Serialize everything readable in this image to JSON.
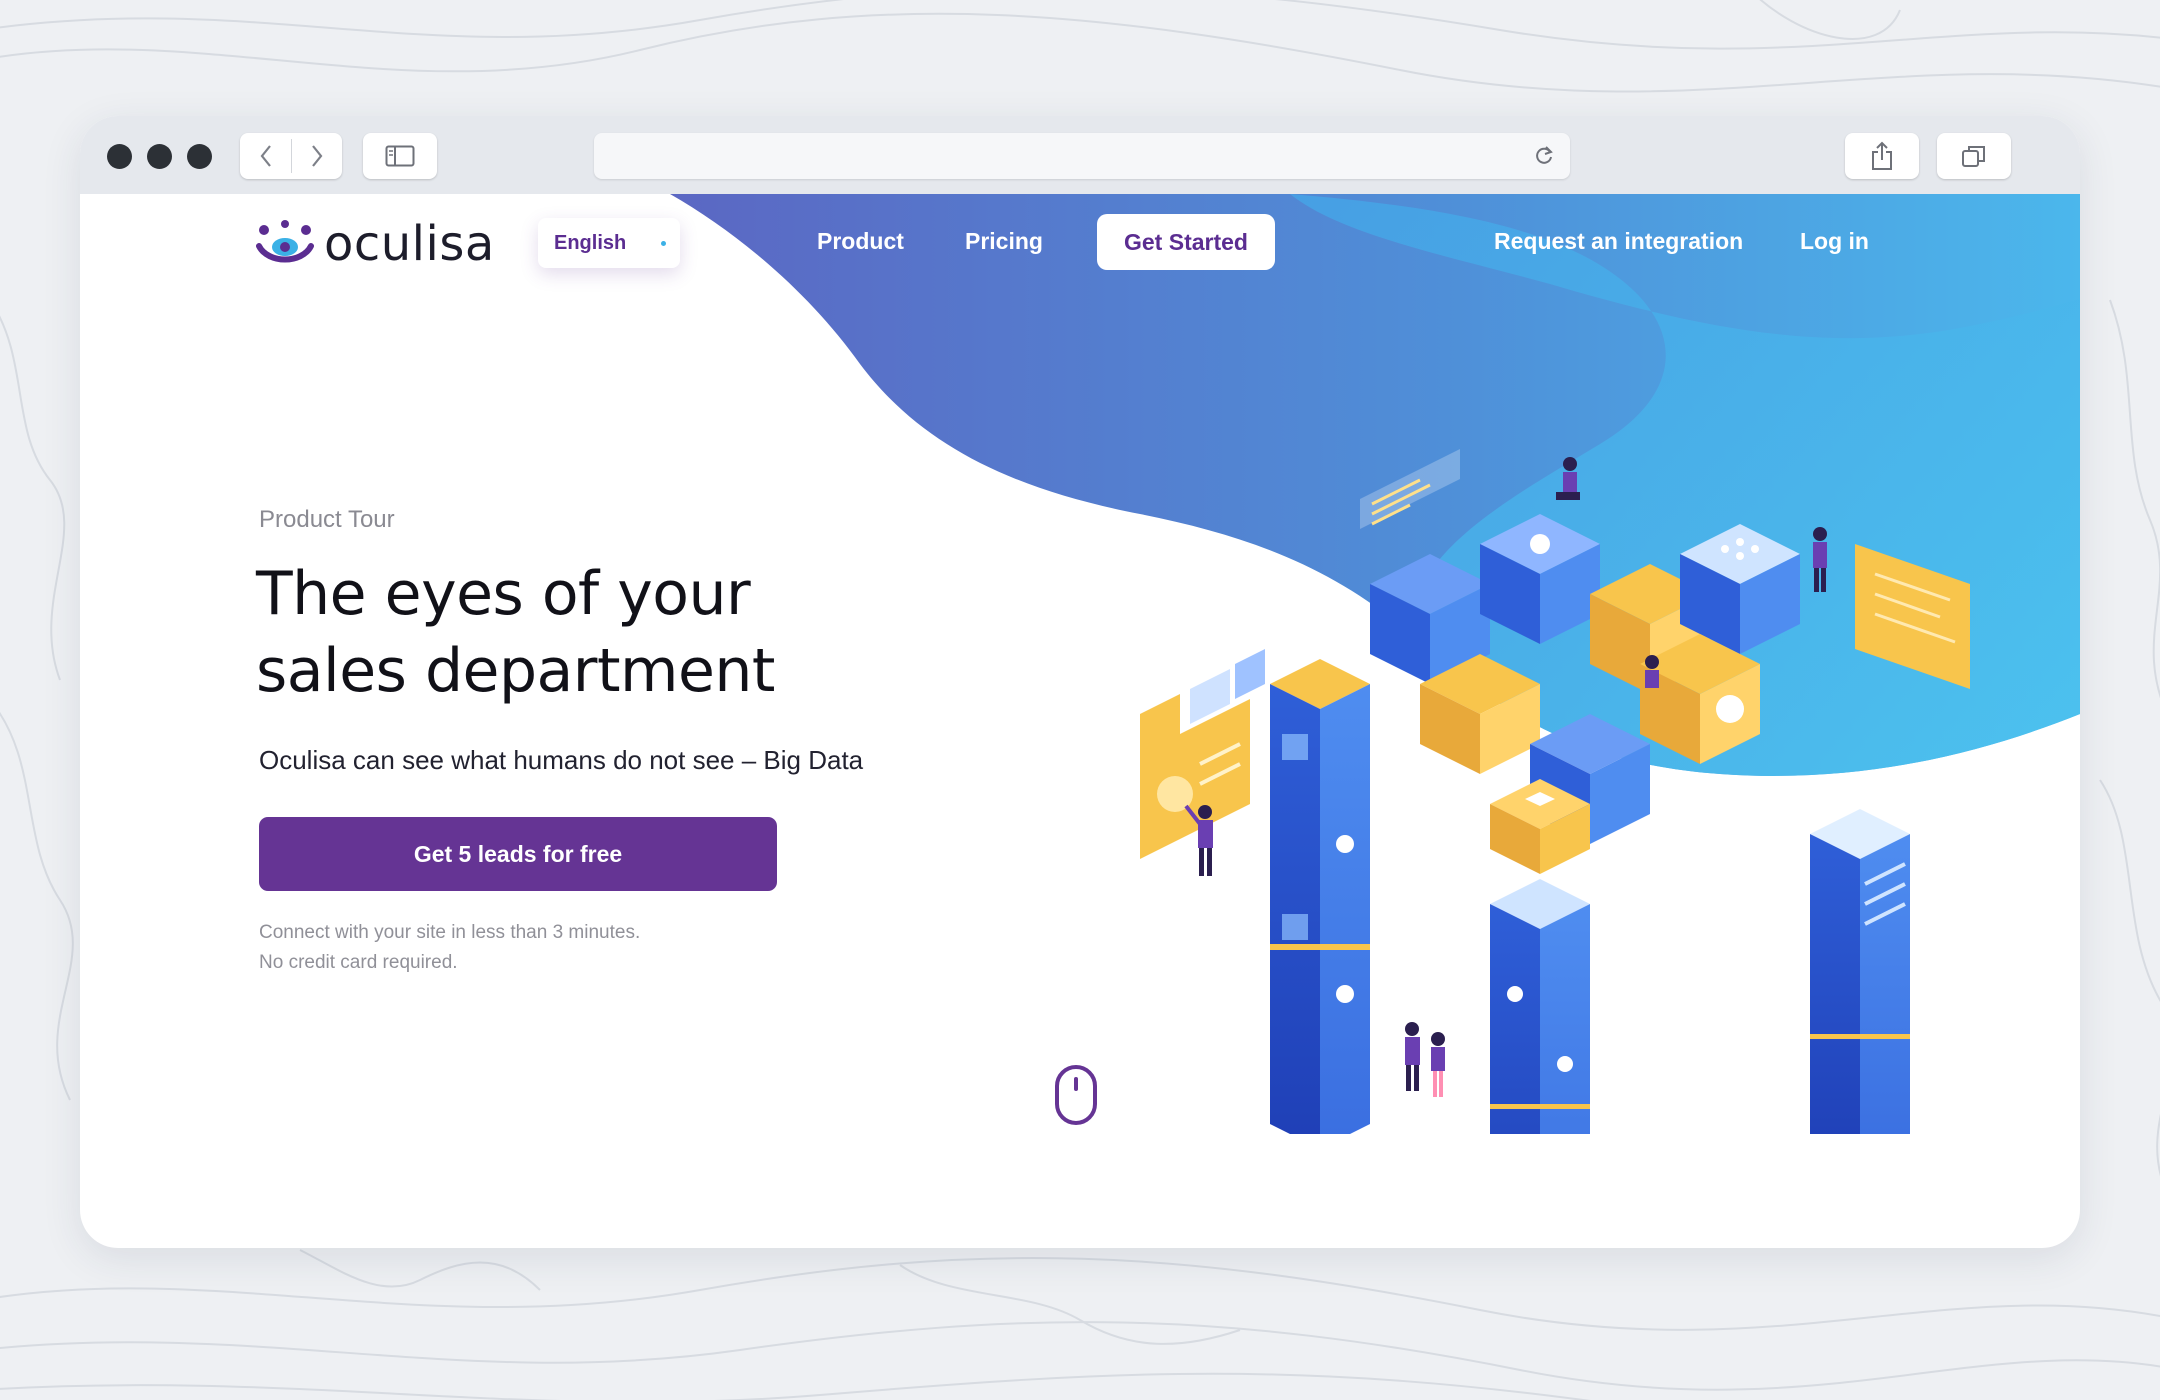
{
  "header": {
    "logo_text": "oculisa",
    "language": "English",
    "nav": {
      "product": "Product",
      "pricing": "Pricing",
      "get_started": "Get Started",
      "request_integration": "Request an integration",
      "login": "Log in"
    }
  },
  "hero": {
    "eyebrow": "Product Tour",
    "headline_line1": "The eyes of your",
    "headline_line2": "sales department",
    "subheadline": "Oculisa can see what humans do not see – Big Data",
    "cta_label": "Get 5 leads for free",
    "note_line1": "Connect with your site in less than 3 minutes.",
    "note_line2": "No credit card required."
  },
  "icons": {
    "browser_back": "chevron-left-icon",
    "browser_forward": "chevron-right-icon",
    "sidebar": "sidebar-icon",
    "reload": "reload-icon",
    "share": "share-icon",
    "tabs": "tabs-icon",
    "scroll": "mouse-scroll-icon"
  },
  "colors": {
    "brand_purple": "#653494",
    "wave_blue": "#5b8fd8",
    "wave_cyan": "#47c6ef",
    "accent_yellow": "#f8c54c"
  }
}
